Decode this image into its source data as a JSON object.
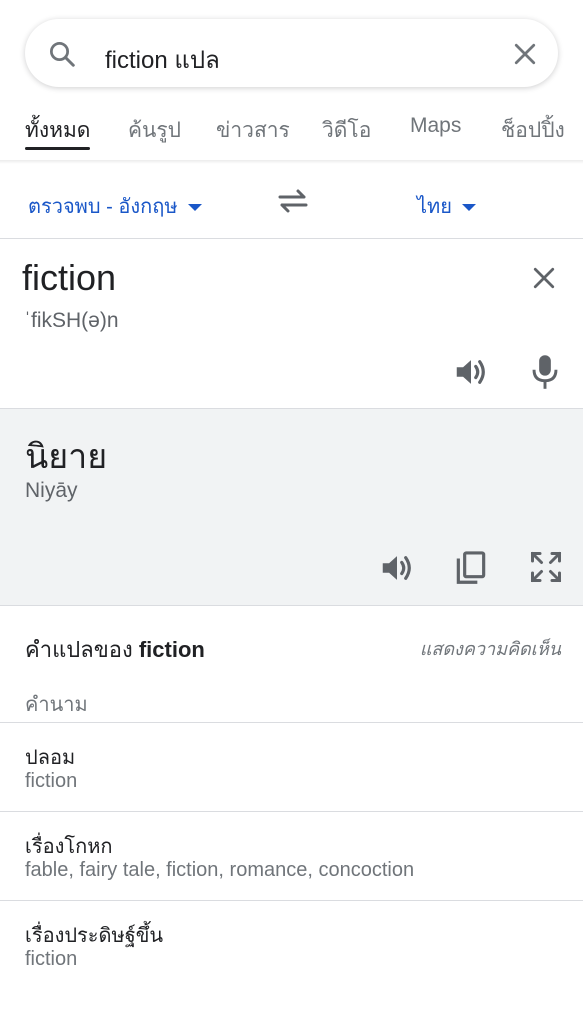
{
  "search": {
    "query": "fiction แปล",
    "icons": [
      "search-icon",
      "close-icon"
    ]
  },
  "tabs": [
    {
      "label": "ทั้งหมด",
      "active": true
    },
    {
      "label": "ค้นรูป",
      "active": false
    },
    {
      "label": "ข่าวสาร",
      "active": false
    },
    {
      "label": "วิดีโอ",
      "active": false
    },
    {
      "label": "Maps",
      "active": false
    },
    {
      "label": "ช็อปปิ้ง",
      "active": false
    }
  ],
  "translator": {
    "source_lang": "ตรวจพบ - อังกฤษ",
    "target_lang": "ไทย",
    "source_word": "fiction",
    "phonetic": "ˈfikSH(ə)n",
    "target_word": "นิยาย",
    "romanization": "Niyāy"
  },
  "translations": {
    "title_prefix": "คำแปลของ",
    "title_word": "fiction",
    "feedback": "แสดงความคิดเห็น",
    "part_of_speech": "คำนาม",
    "entries": [
      {
        "term": "ปลอม",
        "synonyms": "fiction"
      },
      {
        "term": "เรื่องโกหก",
        "synonyms": "fable, fairy tale, fiction, romance, concoction"
      },
      {
        "term": "เรื่องประดิษฐ์ขึ้น",
        "synonyms": "fiction"
      }
    ]
  },
  "colors": {
    "link_blue": "#1a57c8",
    "icon_gray": "#5f6368",
    "target_bg": "#f1f3f4"
  }
}
